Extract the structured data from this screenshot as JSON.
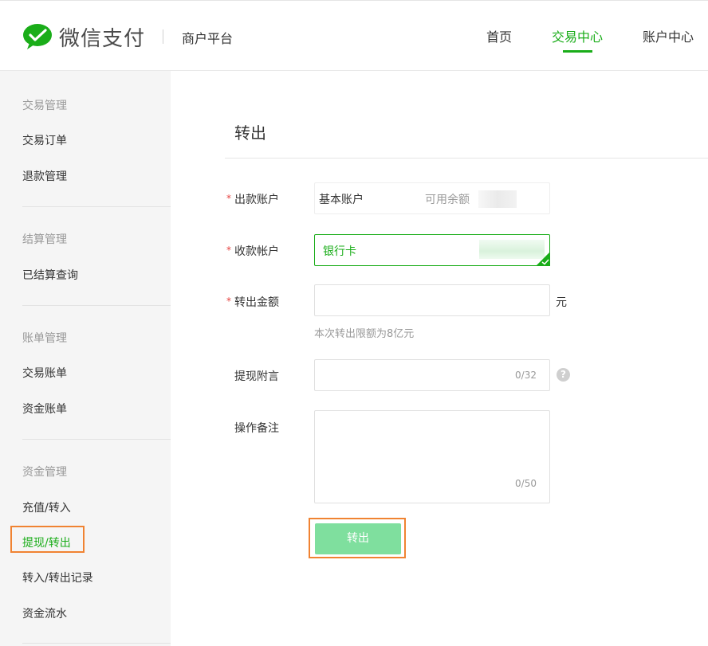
{
  "header": {
    "brand": "微信支付",
    "platform": "商户平台",
    "nav": [
      {
        "label": "首页"
      },
      {
        "label": "交易中心"
      },
      {
        "label": "账户中心"
      }
    ],
    "active_nav": "交易中心"
  },
  "sidebar": {
    "groups": [
      {
        "title": "交易管理",
        "items": [
          "交易订单",
          "退款管理"
        ]
      },
      {
        "title": "结算管理",
        "items": [
          "已结算查询"
        ]
      },
      {
        "title": "账单管理",
        "items": [
          "交易账单",
          "资金账单"
        ]
      },
      {
        "title": "资金管理",
        "items": [
          "充值/转入",
          "提现/转出",
          "转入/转出记录",
          "资金流水"
        ]
      }
    ],
    "active_item": "提现/转出"
  },
  "form": {
    "title": "转出",
    "required_mark": "*",
    "payout_account": {
      "label": "出款账户",
      "value": "基本账户",
      "balance_label": "可用余额"
    },
    "receive_account": {
      "label": "收款帐户",
      "value": "银行卡"
    },
    "amount": {
      "label": "转出金额",
      "value": "",
      "unit": "元",
      "hint": "本次转出限额为8亿元"
    },
    "withdraw_note": {
      "label": "提现附言",
      "value": "",
      "counter": "0/32",
      "help": "?"
    },
    "remark": {
      "label": "操作备注",
      "value": "",
      "counter": "0/50"
    },
    "submit_label": "转出"
  },
  "colors": {
    "accent": "#1aad19",
    "button_disabled": "#7fdf9e",
    "highlight_outline": "#f08332",
    "required": "#e64340"
  }
}
